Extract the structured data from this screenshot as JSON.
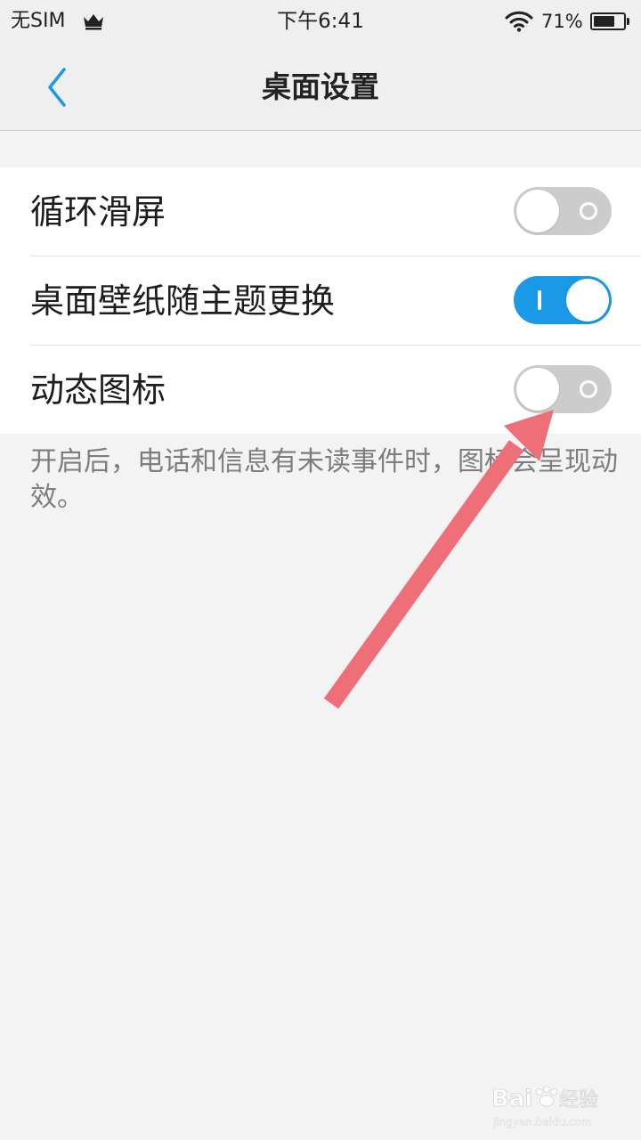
{
  "status_bar": {
    "carrier": "无SIM",
    "time": "下午6:41",
    "battery_percent": "71%",
    "battery_level": 0.71,
    "icons": [
      "crown-icon",
      "wifi-icon",
      "battery-icon"
    ]
  },
  "nav": {
    "back_icon": "chevron-left-icon",
    "title": "桌面设置"
  },
  "settings": [
    {
      "label": "循环滑屏",
      "enabled": false
    },
    {
      "label": "桌面壁纸随主题更换",
      "enabled": true
    },
    {
      "label": "动态图标",
      "enabled": false
    }
  ],
  "description": "开启后，电话和信息有未读事件时，图标会呈现动效。",
  "colors": {
    "accent": "#1a9ae6",
    "toggle_off": "#cccccc",
    "background": "#f3f3f3",
    "annotation_arrow": "#ee6f78"
  },
  "watermark": {
    "text": "Baidu经验",
    "url_text": "jingyan.baidu.com"
  }
}
